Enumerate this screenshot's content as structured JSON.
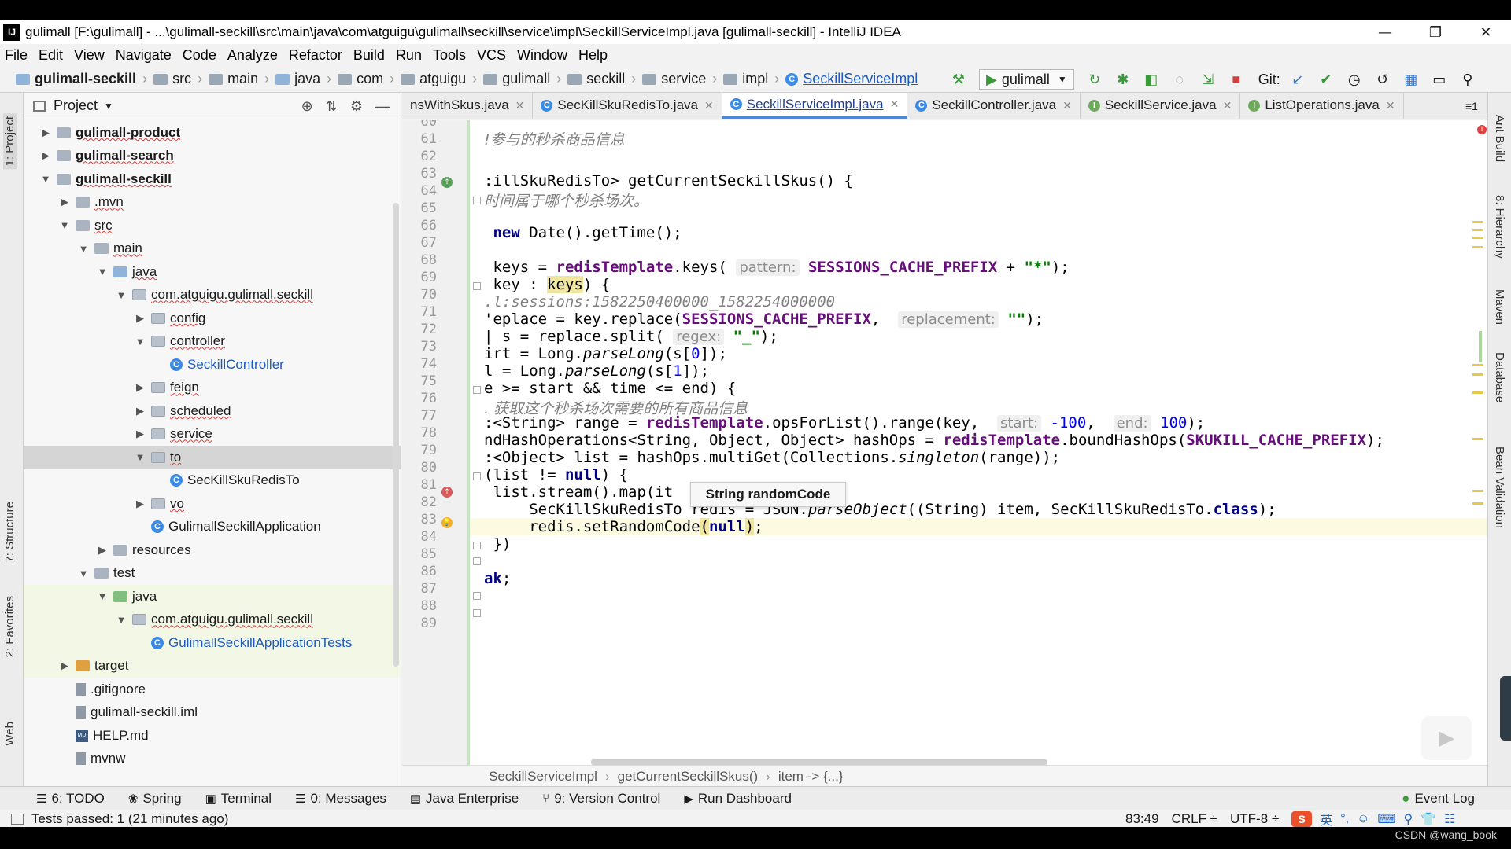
{
  "window": {
    "title": "gulimall [F:\\gulimall] - ...\\gulimall-seckill\\src\\main\\java\\com\\atguigu\\gulimall\\seckill\\service\\impl\\SeckillServiceImpl.java [gulimall-seckill] - IntelliJ IDEA",
    "logo": "IJ"
  },
  "menu": [
    "File",
    "Edit",
    "View",
    "Navigate",
    "Code",
    "Analyze",
    "Refactor",
    "Build",
    "Run",
    "Tools",
    "VCS",
    "Window",
    "Help"
  ],
  "nav": {
    "crumbs": [
      "gulimall-seckill",
      "src",
      "main",
      "java",
      "com",
      "atguigu",
      "gulimall",
      "seckill",
      "service",
      "impl",
      "SeckillServiceImpl"
    ],
    "run_config": "gulimall",
    "git_label": "Git:"
  },
  "side_tabs_left": [
    "1: Project",
    "7: Structure",
    "2: Favorites",
    "Web"
  ],
  "side_tabs_right": [
    "Ant Build",
    "8: Hierarchy",
    "Maven",
    "Database",
    "Bean Validation"
  ],
  "project": {
    "header": "Project",
    "tree": [
      {
        "label": "gulimall-product",
        "level": 0,
        "arrow": "▶",
        "icon": "folder",
        "bold": true
      },
      {
        "label": "gulimall-search",
        "level": 0,
        "arrow": "▶",
        "icon": "folder",
        "bold": true
      },
      {
        "label": "gulimall-seckill",
        "level": 0,
        "arrow": "▼",
        "icon": "folder",
        "bold": true
      },
      {
        "label": ".mvn",
        "level": 1,
        "arrow": "▶",
        "icon": "folder"
      },
      {
        "label": "src",
        "level": 1,
        "arrow": "▼",
        "icon": "folder"
      },
      {
        "label": "main",
        "level": 2,
        "arrow": "▼",
        "icon": "folder"
      },
      {
        "label": "java",
        "level": 3,
        "arrow": "▼",
        "icon": "src"
      },
      {
        "label": "com.atguigu.gulimall.seckill",
        "level": 4,
        "arrow": "▼",
        "icon": "pkg"
      },
      {
        "label": "config",
        "level": 5,
        "arrow": "▶",
        "icon": "pkg"
      },
      {
        "label": "controller",
        "level": 5,
        "arrow": "▼",
        "icon": "pkg"
      },
      {
        "label": "SeckillController",
        "level": 6,
        "arrow": "",
        "icon": "class",
        "blue": true
      },
      {
        "label": "feign",
        "level": 5,
        "arrow": "▶",
        "icon": "pkg"
      },
      {
        "label": "scheduled",
        "level": 5,
        "arrow": "▶",
        "icon": "pkg"
      },
      {
        "label": "service",
        "level": 5,
        "arrow": "▶",
        "icon": "pkg"
      },
      {
        "label": "to",
        "level": 5,
        "arrow": "▼",
        "icon": "pkg",
        "selected": true
      },
      {
        "label": "SecKillSkuRedisTo",
        "level": 6,
        "arrow": "",
        "icon": "class"
      },
      {
        "label": "vo",
        "level": 5,
        "arrow": "▶",
        "icon": "pkg"
      },
      {
        "label": "GulimallSeckillApplication",
        "level": 5,
        "arrow": "",
        "icon": "class"
      },
      {
        "label": "resources",
        "level": 3,
        "arrow": "▶",
        "icon": "res"
      },
      {
        "label": "test",
        "level": 2,
        "arrow": "▼",
        "icon": "folder"
      },
      {
        "label": "java",
        "level": 3,
        "arrow": "▼",
        "icon": "green",
        "test": true
      },
      {
        "label": "com.atguigu.gulimall.seckill",
        "level": 4,
        "arrow": "▼",
        "icon": "pkg",
        "test": true
      },
      {
        "label": "GulimallSeckillApplicationTests",
        "level": 5,
        "arrow": "",
        "icon": "class",
        "blue": true,
        "test": true
      },
      {
        "label": "target",
        "level": 1,
        "arrow": "▶",
        "icon": "orange",
        "test": true
      },
      {
        "label": ".gitignore",
        "level": 1,
        "arrow": "",
        "icon": "file"
      },
      {
        "label": "gulimall-seckill.iml",
        "level": 1,
        "arrow": "",
        "icon": "file"
      },
      {
        "label": "HELP.md",
        "level": 1,
        "arrow": "",
        "icon": "md"
      },
      {
        "label": "mvnw",
        "level": 1,
        "arrow": "",
        "icon": "file"
      }
    ]
  },
  "tabs": [
    {
      "label": "nsWithSkus.java",
      "icon": "none"
    },
    {
      "label": "SecKillSkuRedisTo.java",
      "icon": "class"
    },
    {
      "label": "SeckillServiceImpl.java",
      "icon": "class",
      "active": true
    },
    {
      "label": "SeckillController.java",
      "icon": "class"
    },
    {
      "label": "SeckillService.java",
      "icon": "interface"
    },
    {
      "label": "ListOperations.java",
      "icon": "interface"
    }
  ],
  "tabs_more": "≡1",
  "editor": {
    "line_numbers": [
      "60",
      "61",
      "62",
      "63",
      "64",
      "65",
      "66",
      "67",
      "68",
      "69",
      "70",
      "71",
      "72",
      "73",
      "74",
      "75",
      "76",
      "77",
      "78",
      "79",
      "80",
      "81",
      "82",
      "83",
      "84",
      "85",
      "86",
      "87",
      "88",
      "89"
    ],
    "tooltip": "String randomCode",
    "cursor_line": "83"
  },
  "code_breadcrumb": [
    "SeckillServiceImpl",
    "getCurrentSeckillSkus()",
    "item -> {...}"
  ],
  "tool_windows": [
    {
      "icon": "☰",
      "label": "6: TODO"
    },
    {
      "icon": "❀",
      "label": "Spring"
    },
    {
      "icon": "▣",
      "label": "Terminal"
    },
    {
      "icon": "☰",
      "label": "0: Messages"
    },
    {
      "icon": "▤",
      "label": "Java Enterprise"
    },
    {
      "icon": "⑂",
      "label": "9: Version Control"
    },
    {
      "icon": "▶",
      "label": "Run Dashboard"
    }
  ],
  "event_log": "Event Log",
  "status": {
    "message": "Tests passed: 1 (21 minutes ago)",
    "position": "83:49",
    "line_sep": "CRLF ÷",
    "encoding": "UTF-8 ÷",
    "ime_chars": [
      "英",
      "°,",
      "☺",
      "⌨",
      "⚲",
      "👕",
      "☷"
    ]
  },
  "watermark": "CSDN @wang_book"
}
